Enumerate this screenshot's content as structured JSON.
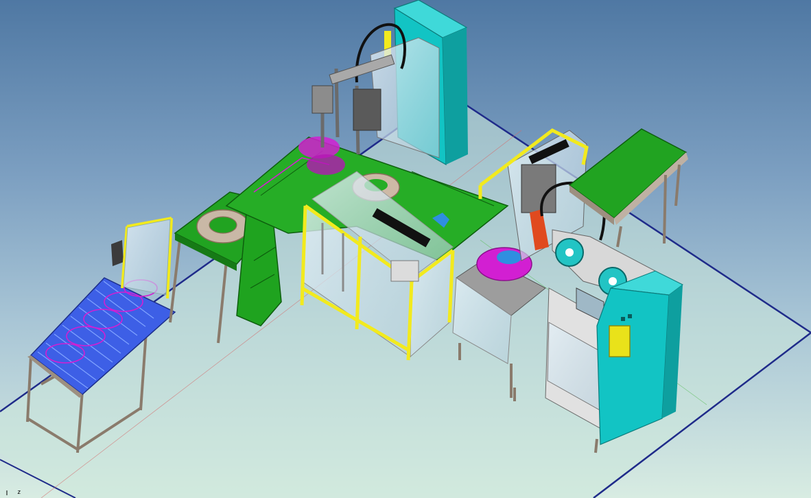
{
  "viewport": {
    "axis_indicator": "z"
  },
  "colors": {
    "background_top": "#4f78a3",
    "background_bottom": "#d8ece2",
    "floor_grid": "#c8e6dc",
    "floor_edge": "#1f2b8a",
    "conveyor_green": "#1fa31f",
    "guard_yellow": "#f2ea1e",
    "cabinet_cyan": "#11c6c6",
    "frame_tan": "#b8a89a",
    "part_magenta": "#d21fd2",
    "roller_blue": "#3a5ae0",
    "cable_black": "#111111",
    "glass": "#cfe3ef"
  },
  "icons": {
    "view_triad": "axis-triad-icon"
  }
}
